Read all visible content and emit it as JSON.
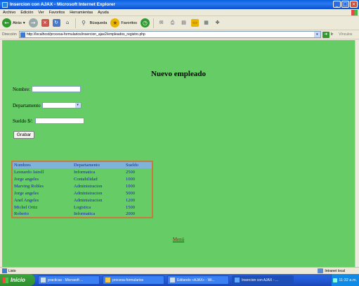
{
  "window": {
    "title": "Insercion con AJAX - Microsoft Internet Explorer"
  },
  "menubar": [
    "Archivo",
    "Edición",
    "Ver",
    "Favoritos",
    "Herramientas",
    "Ayuda"
  ],
  "toolbar": {
    "back": "Atrás",
    "search": "Búsqueda",
    "favorites": "Favoritos"
  },
  "address": {
    "label": "Dirección",
    "url": "http://localhost/procesa-formularios/insercion_ajax2/empleados_registro.php",
    "go": "Ir",
    "links": "Vínculos"
  },
  "page": {
    "heading": "Nuevo empleado",
    "nombre_label": "Nombre:",
    "departamento_label": "Departamento",
    "sueldo_label": "Sueldo $/:",
    "grabar_button": "Grabar",
    "table_headers": [
      "Nombres",
      "Departamento",
      "Sueldo"
    ],
    "rows": [
      [
        "Leonardo Jairell",
        "Informatica",
        "2500"
      ],
      [
        "Jorge angeles",
        "Contabilidad",
        "1000"
      ],
      [
        "Marving Robles",
        "Administracion",
        "1000"
      ],
      [
        "Jorge angeles",
        "Administracion",
        "5000"
      ],
      [
        "Anel Angeles",
        "Administracion",
        "1200"
      ],
      [
        "Michel Ortiz",
        "Logistica",
        "1500"
      ],
      [
        "Roberto",
        "Informatica",
        "2000"
      ]
    ],
    "menu_link": "Menú"
  },
  "statusbar": {
    "text": "Listo",
    "zone": "Intranet local"
  },
  "taskbar": {
    "start": "Inicio",
    "tasks": [
      "practicas - Microsoft ...",
      "procesa-formularios",
      "Editando «AJAX» - Wi...",
      "Insercion con AJAX - ..."
    ],
    "clock": "11:32 a.m."
  },
  "colors": {
    "page_bg": "#66cc66",
    "table_border": "#c87a3c",
    "header_bg": "#7fb3d8",
    "link": "#8b1a1a"
  }
}
